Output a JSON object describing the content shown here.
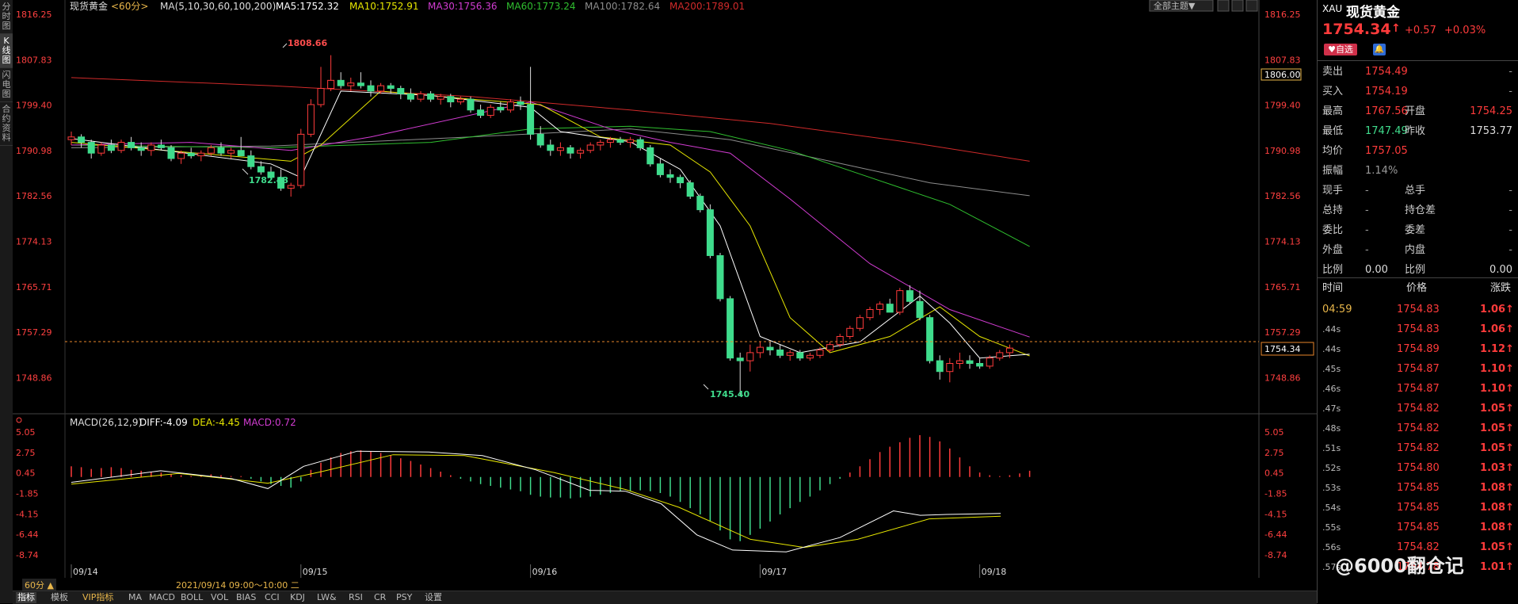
{
  "left_rail": [
    "分时图",
    "K线图",
    "闪电图",
    "合约资料"
  ],
  "header": {
    "symbol": "现货黄金",
    "period": "<60分>",
    "ma_params": "MA(5,10,30,60,100,200)",
    "ma5": "MA5:1752.32",
    "ma10": "MA10:1752.91",
    "ma30": "MA30:1756.36",
    "ma60": "MA60:1773.24",
    "ma100": "MA100:1782.64",
    "ma200": "MA200:1789.01",
    "theme_button": "全部主题▼"
  },
  "colors": {
    "up": "#ff3b3b",
    "down": "#3fdc8c",
    "ma5": "#ffffff",
    "ma10": "#e6e600",
    "ma30": "#d23cd2",
    "ma60": "#2fbf2f",
    "ma100": "#8c8c8c",
    "ma200": "#d02a2a",
    "macd_diff": "#ffffff",
    "macd_dea": "#e6e600",
    "axis": "#ff4040"
  },
  "price_axis": [
    "1816.25",
    "1807.83",
    "1799.40",
    "1790.98",
    "1782.56",
    "1774.13",
    "1765.71",
    "1757.29",
    "1748.86"
  ],
  "price_markers": {
    "high_label": "1808.66",
    "low_label_1": "1782.43",
    "low_label_2": "1745.40",
    "crosshair_price": "1806.00",
    "last_price": "1754.34"
  },
  "macd": {
    "title": "MACD(26,12,9)",
    "diff": "DIFF:-4.09",
    "dea": "DEA:-4.45",
    "macd": "MACD:0.72",
    "axis": [
      "5.05",
      "2.75",
      "0.45",
      "-1.85",
      "-4.15",
      "-6.44",
      "-8.74"
    ]
  },
  "dates": [
    "09/14",
    "09/15",
    "09/16",
    "09/17",
    "09/18"
  ],
  "status": {
    "period_btn": "60分 ▲",
    "range": "2021/09/14 09:00～10:00 二"
  },
  "bottom_tabs": [
    "指标",
    "模板",
    "VIP指标",
    "MA",
    "MACD",
    "BOLL",
    "VOL",
    "BIAS",
    "CCI",
    "KDJ",
    "LW&",
    "RSI",
    "CR",
    "PSY",
    "设置"
  ],
  "quote": {
    "code": "XAU",
    "name": "现货黄金",
    "price": "1754.34",
    "arrow": "↑",
    "change": "+0.57",
    "pct": "+0.03%",
    "badge": "自选",
    "rows": [
      {
        "l1": "卖出",
        "v1": "1754.49",
        "l2": "",
        "v2": "-"
      },
      {
        "l1": "买入",
        "v1": "1754.19",
        "l2": "",
        "v2": "-"
      },
      {
        "l1": "最高",
        "v1": "1767.56",
        "l2": "开盘",
        "v2": "1754.25"
      },
      {
        "l1": "最低",
        "v1": "1747.49",
        "l2": "昨收",
        "v2": "1753.77"
      },
      {
        "l1": "均价",
        "v1": "1757.05",
        "l2": "",
        "v2": ""
      },
      {
        "l1": "振幅",
        "v1": "1.14%",
        "l2": "",
        "v2": ""
      },
      {
        "l1": "现手",
        "v1": "-",
        "l2": "总手",
        "v2": "-"
      },
      {
        "l1": "总持",
        "v1": "-",
        "l2": "持仓差",
        "v2": "-"
      },
      {
        "l1": "委比",
        "v1": "-",
        "l2": "委差",
        "v2": "-"
      },
      {
        "l1": "外盘",
        "v1": "-",
        "l2": "内盘",
        "v2": "-"
      },
      {
        "l1": "比例",
        "v1": "0.00",
        "l2": "比例",
        "v2": "0.00"
      }
    ],
    "ticks_header": [
      "时间",
      "价格",
      "涨跌"
    ],
    "ticks": [
      {
        "t": "04:59",
        "p": "1754.83",
        "c": "1.06↑"
      },
      {
        "t": ".44s",
        "p": "1754.83",
        "c": "1.06↑"
      },
      {
        "t": ".44s",
        "p": "1754.89",
        "c": "1.12↑"
      },
      {
        "t": ".45s",
        "p": "1754.87",
        "c": "1.10↑"
      },
      {
        "t": ".46s",
        "p": "1754.87",
        "c": "1.10↑"
      },
      {
        "t": ".47s",
        "p": "1754.82",
        "c": "1.05↑"
      },
      {
        "t": ".48s",
        "p": "1754.82",
        "c": "1.05↑"
      },
      {
        "t": ".51s",
        "p": "1754.82",
        "c": "1.05↑"
      },
      {
        "t": ".52s",
        "p": "1754.80",
        "c": "1.03↑"
      },
      {
        "t": ".53s",
        "p": "1754.85",
        "c": "1.08↑"
      },
      {
        "t": ".54s",
        "p": "1754.85",
        "c": "1.08↑"
      },
      {
        "t": ".55s",
        "p": "1754.85",
        "c": "1.08↑"
      },
      {
        "t": ".56s",
        "p": "1754.82",
        "c": "1.05↑"
      },
      {
        "t": ".57s",
        "p": "1754.78",
        "c": "1.01↑"
      }
    ]
  },
  "watermark": "@6000翻仓记",
  "chart_data": {
    "type": "candlestick",
    "ylim": [
      1745.4,
      1816.25
    ],
    "candles": [
      [
        1793.0,
        1794.5,
        1792.0,
        1793.5
      ],
      [
        1793.5,
        1794.0,
        1791.5,
        1792.5
      ],
      [
        1792.5,
        1793.0,
        1789.5,
        1790.5
      ],
      [
        1790.5,
        1792.5,
        1790.0,
        1792.0
      ],
      [
        1792.0,
        1793.0,
        1790.5,
        1791.0
      ],
      [
        1791.0,
        1793.0,
        1790.5,
        1792.5
      ],
      [
        1792.5,
        1793.5,
        1791.0,
        1791.5
      ],
      [
        1791.5,
        1792.5,
        1790.0,
        1791.0
      ],
      [
        1791.0,
        1792.5,
        1790.0,
        1792.0
      ],
      [
        1792.0,
        1793.0,
        1791.0,
        1791.5
      ],
      [
        1791.5,
        1792.0,
        1789.0,
        1789.5
      ],
      [
        1789.5,
        1791.0,
        1788.5,
        1790.5
      ],
      [
        1790.5,
        1791.5,
        1789.5,
        1790.0
      ],
      [
        1790.0,
        1791.0,
        1789.0,
        1790.5
      ],
      [
        1790.5,
        1792.0,
        1790.0,
        1791.5
      ],
      [
        1791.5,
        1792.5,
        1790.0,
        1790.5
      ],
      [
        1790.5,
        1791.5,
        1789.5,
        1791.0
      ],
      [
        1791.0,
        1793.5,
        1790.5,
        1790.0
      ],
      [
        1790.0,
        1791.0,
        1787.5,
        1788.0
      ],
      [
        1788.0,
        1789.0,
        1786.5,
        1787.0
      ],
      [
        1787.0,
        1788.0,
        1785.5,
        1786.0
      ],
      [
        1786.0,
        1787.5,
        1783.5,
        1784.0
      ],
      [
        1784.0,
        1785.0,
        1782.43,
        1784.5
      ],
      [
        1784.5,
        1795.0,
        1784.0,
        1794.0
      ],
      [
        1794.0,
        1800.5,
        1793.5,
        1799.5
      ],
      [
        1799.5,
        1806.5,
        1799.0,
        1802.5
      ],
      [
        1802.5,
        1808.66,
        1802.0,
        1804.0
      ],
      [
        1804.0,
        1805.5,
        1802.5,
        1803.0
      ],
      [
        1803.0,
        1804.5,
        1802.0,
        1803.5
      ],
      [
        1803.5,
        1805.5,
        1802.5,
        1803.0
      ],
      [
        1803.0,
        1804.0,
        1801.0,
        1802.0
      ],
      [
        1802.0,
        1803.5,
        1801.5,
        1803.0
      ],
      [
        1803.0,
        1803.5,
        1801.5,
        1802.5
      ],
      [
        1802.5,
        1803.0,
        1800.5,
        1801.5
      ],
      [
        1801.5,
        1802.5,
        1800.0,
        1800.5
      ],
      [
        1800.5,
        1802.0,
        1800.0,
        1801.5
      ],
      [
        1801.5,
        1802.0,
        1800.0,
        1800.5
      ],
      [
        1800.5,
        1801.5,
        1799.5,
        1801.0
      ],
      [
        1801.0,
        1801.5,
        1799.0,
        1800.0
      ],
      [
        1800.0,
        1801.0,
        1799.5,
        1800.5
      ],
      [
        1800.5,
        1801.0,
        1798.0,
        1798.5
      ],
      [
        1798.5,
        1799.5,
        1797.0,
        1797.5
      ],
      [
        1797.5,
        1799.5,
        1797.0,
        1799.0
      ],
      [
        1799.0,
        1800.0,
        1798.0,
        1798.5
      ],
      [
        1798.5,
        1800.5,
        1798.0,
        1800.0
      ],
      [
        1800.0,
        1801.0,
        1798.5,
        1799.5
      ],
      [
        1799.5,
        1806.5,
        1793.0,
        1794.0
      ],
      [
        1794.0,
        1795.5,
        1791.5,
        1792.0
      ],
      [
        1792.0,
        1793.0,
        1790.0,
        1791.0
      ],
      [
        1791.0,
        1792.5,
        1790.0,
        1791.5
      ],
      [
        1791.5,
        1792.0,
        1789.5,
        1790.5
      ],
      [
        1790.5,
        1791.5,
        1789.5,
        1791.0
      ],
      [
        1791.0,
        1792.5,
        1790.5,
        1792.0
      ],
      [
        1792.0,
        1793.0,
        1791.0,
        1792.5
      ],
      [
        1792.5,
        1793.5,
        1791.5,
        1793.0
      ],
      [
        1793.0,
        1793.5,
        1792.0,
        1792.5
      ],
      [
        1792.5,
        1793.5,
        1791.5,
        1793.0
      ],
      [
        1793.0,
        1793.5,
        1791.0,
        1791.5
      ],
      [
        1791.5,
        1792.0,
        1788.0,
        1788.5
      ],
      [
        1788.5,
        1789.5,
        1786.0,
        1786.5
      ],
      [
        1786.5,
        1787.5,
        1785.0,
        1786.0
      ],
      [
        1786.0,
        1786.5,
        1784.0,
        1785.0
      ],
      [
        1785.0,
        1785.5,
        1782.0,
        1782.5
      ],
      [
        1782.5,
        1783.0,
        1779.5,
        1780.0
      ],
      [
        1780.0,
        1781.0,
        1771.0,
        1771.5
      ],
      [
        1771.5,
        1772.0,
        1763.0,
        1763.5
      ],
      [
        1763.5,
        1764.0,
        1752.0,
        1752.5
      ],
      [
        1752.5,
        1753.5,
        1745.4,
        1752.0
      ],
      [
        1752.0,
        1755.0,
        1750.0,
        1753.5
      ],
      [
        1753.5,
        1755.5,
        1752.5,
        1754.5
      ],
      [
        1754.5,
        1755.5,
        1753.0,
        1754.0
      ],
      [
        1754.0,
        1755.0,
        1752.5,
        1753.0
      ],
      [
        1753.0,
        1754.0,
        1752.0,
        1753.5
      ],
      [
        1753.5,
        1754.0,
        1752.0,
        1752.5
      ],
      [
        1752.5,
        1753.5,
        1752.0,
        1753.0
      ],
      [
        1753.0,
        1754.5,
        1752.5,
        1754.0
      ],
      [
        1754.0,
        1755.5,
        1753.5,
        1755.0
      ],
      [
        1755.0,
        1757.0,
        1754.5,
        1756.5
      ],
      [
        1756.5,
        1758.5,
        1756.0,
        1758.0
      ],
      [
        1758.0,
        1760.5,
        1757.5,
        1760.0
      ],
      [
        1760.0,
        1762.0,
        1759.5,
        1761.5
      ],
      [
        1761.5,
        1763.0,
        1760.5,
        1762.5
      ],
      [
        1762.5,
        1763.5,
        1761.0,
        1761.0
      ],
      [
        1761.0,
        1765.5,
        1760.5,
        1765.0
      ],
      [
        1765.0,
        1766.0,
        1762.5,
        1763.0
      ],
      [
        1763.0,
        1765.0,
        1759.5,
        1760.0
      ],
      [
        1760.0,
        1760.5,
        1751.5,
        1752.0
      ],
      [
        1752.0,
        1753.0,
        1748.5,
        1750.0
      ],
      [
        1750.0,
        1752.5,
        1748.0,
        1751.5
      ],
      [
        1751.5,
        1753.5,
        1750.5,
        1752.0
      ],
      [
        1752.0,
        1753.0,
        1750.5,
        1751.5
      ],
      [
        1751.5,
        1752.5,
        1750.5,
        1751.0
      ],
      [
        1751.0,
        1753.0,
        1750.5,
        1752.5
      ],
      [
        1752.5,
        1754.0,
        1752.0,
        1753.5
      ],
      [
        1753.5,
        1755.0,
        1752.5,
        1754.34
      ]
    ],
    "ma5": [
      [
        0,
        1793.2
      ],
      [
        20,
        1788.5
      ],
      [
        23,
        1786.0
      ],
      [
        27,
        1802.0
      ],
      [
        36,
        1801.2
      ],
      [
        46,
        1799.0
      ],
      [
        49,
        1794.5
      ],
      [
        56,
        1792.6
      ],
      [
        61,
        1787.5
      ],
      [
        65,
        1777.0
      ],
      [
        69,
        1756.5
      ],
      [
        73,
        1753.5
      ],
      [
        79,
        1755.5
      ],
      [
        85,
        1764.0
      ],
      [
        88,
        1759.0
      ],
      [
        91,
        1752.5
      ],
      [
        96,
        1753.2
      ]
    ],
    "ma10": [
      [
        0,
        1792.5
      ],
      [
        22,
        1789.0
      ],
      [
        25,
        1792.0
      ],
      [
        31,
        1802.0
      ],
      [
        40,
        1800.5
      ],
      [
        47,
        1799.5
      ],
      [
        53,
        1793.5
      ],
      [
        60,
        1792.0
      ],
      [
        64,
        1787.0
      ],
      [
        68,
        1777.0
      ],
      [
        72,
        1760.0
      ],
      [
        76,
        1753.5
      ],
      [
        82,
        1756.5
      ],
      [
        87,
        1762.0
      ],
      [
        91,
        1756.5
      ],
      [
        96,
        1752.9
      ]
    ],
    "ma30": [
      [
        0,
        1792.0
      ],
      [
        12,
        1792.5
      ],
      [
        22,
        1791.0
      ],
      [
        30,
        1793.5
      ],
      [
        46,
        1800.0
      ],
      [
        54,
        1795.0
      ],
      [
        60,
        1792.5
      ],
      [
        66,
        1790.5
      ],
      [
        72,
        1782.0
      ],
      [
        80,
        1770.0
      ],
      [
        88,
        1761.5
      ],
      [
        96,
        1756.4
      ]
    ],
    "ma60": [
      [
        0,
        1792.0
      ],
      [
        20,
        1791.5
      ],
      [
        36,
        1792.5
      ],
      [
        46,
        1795.0
      ],
      [
        56,
        1795.5
      ],
      [
        64,
        1794.5
      ],
      [
        72,
        1791.0
      ],
      [
        80,
        1786.0
      ],
      [
        88,
        1781.0
      ],
      [
        96,
        1773.2
      ]
    ],
    "ma100": [
      [
        0,
        1791.5
      ],
      [
        20,
        1791.8
      ],
      [
        40,
        1793.5
      ],
      [
        56,
        1795.0
      ],
      [
        66,
        1793.0
      ],
      [
        76,
        1789.0
      ],
      [
        86,
        1785.0
      ],
      [
        96,
        1782.6
      ]
    ],
    "ma200": [
      [
        0,
        1804.5
      ],
      [
        20,
        1803.0
      ],
      [
        40,
        1801.0
      ],
      [
        56,
        1798.5
      ],
      [
        70,
        1796.0
      ],
      [
        84,
        1792.5
      ],
      [
        96,
        1789.0
      ]
    ],
    "macd_ylim": [
      -8.74,
      5.05
    ],
    "macd_hist": [
      1.2,
      1.1,
      0.9,
      1.0,
      1.1,
      1.0,
      0.8,
      0.7,
      0.6,
      0.5,
      0.3,
      0.2,
      0.1,
      0.2,
      0.3,
      0.2,
      0.1,
      0.1,
      -0.2,
      -0.5,
      -0.8,
      -1.0,
      -1.2,
      -0.5,
      0.8,
      1.6,
      2.2,
      2.7,
      2.9,
      3.0,
      2.9,
      2.7,
      2.4,
      2.1,
      1.8,
      1.4,
      1.0,
      0.6,
      0.2,
      -0.2,
      -0.5,
      -0.8,
      -1.0,
      -1.2,
      -1.4,
      -1.6,
      -2.0,
      -2.2,
      -2.3,
      -2.3,
      -2.4,
      -2.3,
      -2.2,
      -2.0,
      -1.8,
      -1.6,
      -1.6,
      -1.5,
      -1.6,
      -1.8,
      -2.2,
      -2.8,
      -3.5,
      -4.2,
      -5.0,
      -6.0,
      -7.0,
      -7.2,
      -6.5,
      -5.8,
      -5.0,
      -4.2,
      -3.5,
      -2.8,
      -2.2,
      -1.5,
      -0.8,
      -0.2,
      0.5,
      1.2,
      2.0,
      2.8,
      3.4,
      3.9,
      4.4,
      4.7,
      4.5,
      4.0,
      3.2,
      2.2,
      1.2,
      0.5,
      0.2,
      0.1,
      0.2,
      0.4,
      0.7
    ],
    "macd_diff": [
      [
        0,
        -0.6
      ],
      [
        10,
        0.7
      ],
      [
        18,
        -0.2
      ],
      [
        22,
        -1.3
      ],
      [
        26,
        1.2
      ],
      [
        32,
        2.9
      ],
      [
        40,
        2.8
      ],
      [
        46,
        2.4
      ],
      [
        52,
        0.8
      ],
      [
        58,
        -1.5
      ],
      [
        62,
        -1.6
      ],
      [
        66,
        -3.0
      ],
      [
        70,
        -6.5
      ],
      [
        74,
        -8.2
      ],
      [
        80,
        -8.4
      ],
      [
        86,
        -6.8
      ],
      [
        92,
        -3.8
      ],
      [
        95,
        -4.3
      ],
      [
        98,
        -4.2
      ],
      [
        104,
        -4.1
      ]
    ],
    "macd_dea": [
      [
        0,
        -0.8
      ],
      [
        12,
        0.4
      ],
      [
        22,
        -0.7
      ],
      [
        28,
        0.6
      ],
      [
        36,
        2.5
      ],
      [
        44,
        2.4
      ],
      [
        54,
        0.5
      ],
      [
        62,
        -1.4
      ],
      [
        68,
        -3.4
      ],
      [
        76,
        -7.0
      ],
      [
        82,
        -7.9
      ],
      [
        88,
        -7.0
      ],
      [
        96,
        -4.7
      ],
      [
        104,
        -4.4
      ]
    ]
  }
}
